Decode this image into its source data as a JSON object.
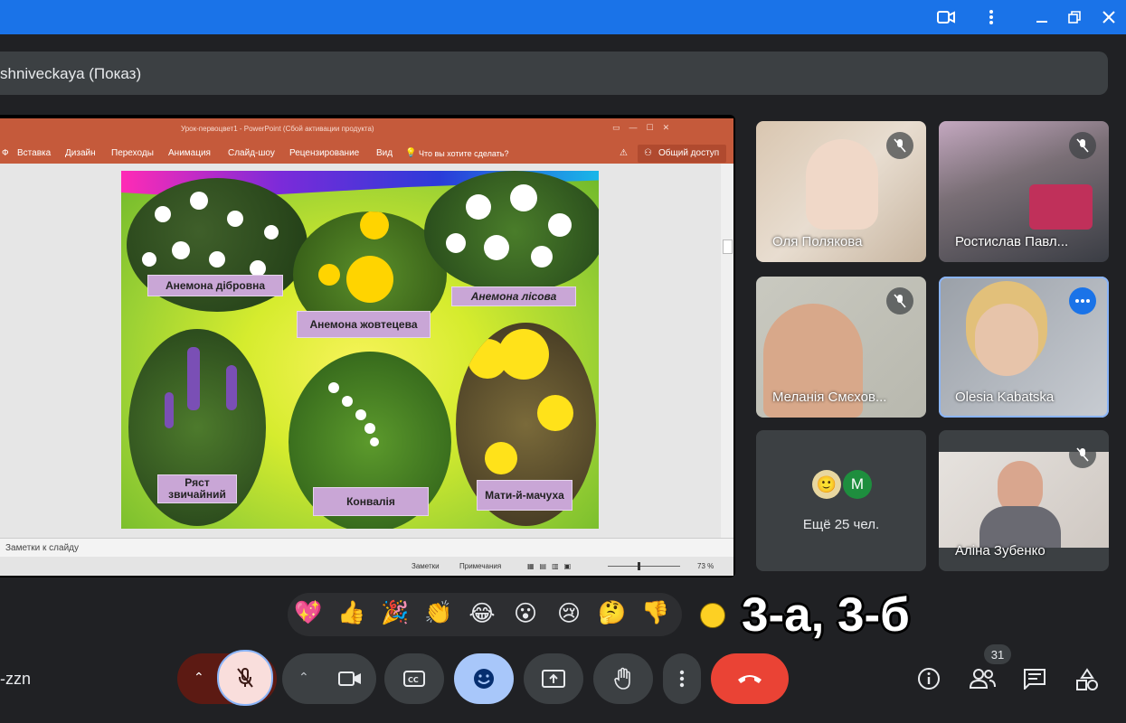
{
  "presenter": {
    "name": "shniveckaya (Показ)"
  },
  "ppt": {
    "title": "Урок-первоцвет1 - PowerPoint (Сбой активации продукта)",
    "ribbon": [
      "Вставка",
      "Дизайн",
      "Переходы",
      "Анимация",
      "Слайд-шоу",
      "Рецензирование",
      "Вид"
    ],
    "search": "Что вы хотите сделать?",
    "share": "Общий доступ",
    "notes": "Заметки к слайду",
    "status": {
      "notes_btn": "Заметки",
      "comments_btn": "Примечания",
      "zoom": "73 %"
    }
  },
  "slide": {
    "labels": [
      "Анемона дібровна",
      "Анемона жовтецева",
      "Анемона лісова",
      "Ряст звичайний",
      "Конвалія",
      "Мати-й-мачуха"
    ]
  },
  "participants": [
    {
      "name": "Оля Полякова",
      "muted": true
    },
    {
      "name": "Ростислав Павл...",
      "muted": true
    },
    {
      "name": "Меланія Смєхов...",
      "muted": true
    },
    {
      "name": "Olesia Kabatska",
      "muted": false
    },
    {
      "name": "Аліна Зубенко",
      "muted": true
    }
  ],
  "more": {
    "label": "Ещё 25 чел.",
    "avatar_letter": "M"
  },
  "reactions": [
    "💖",
    "👍",
    "🎉",
    "👏",
    "😂",
    "😮",
    "😢",
    "🤔",
    "👎"
  ],
  "overlay_text": "3-а, 3-б",
  "meeting_code": "-zzn",
  "people_count": "31",
  "colors": {
    "top_bar": "#1a73e8",
    "end_call": "#ea4335",
    "mic_muted": "#f9dedc",
    "active_reaction": "#a8c7fa"
  }
}
